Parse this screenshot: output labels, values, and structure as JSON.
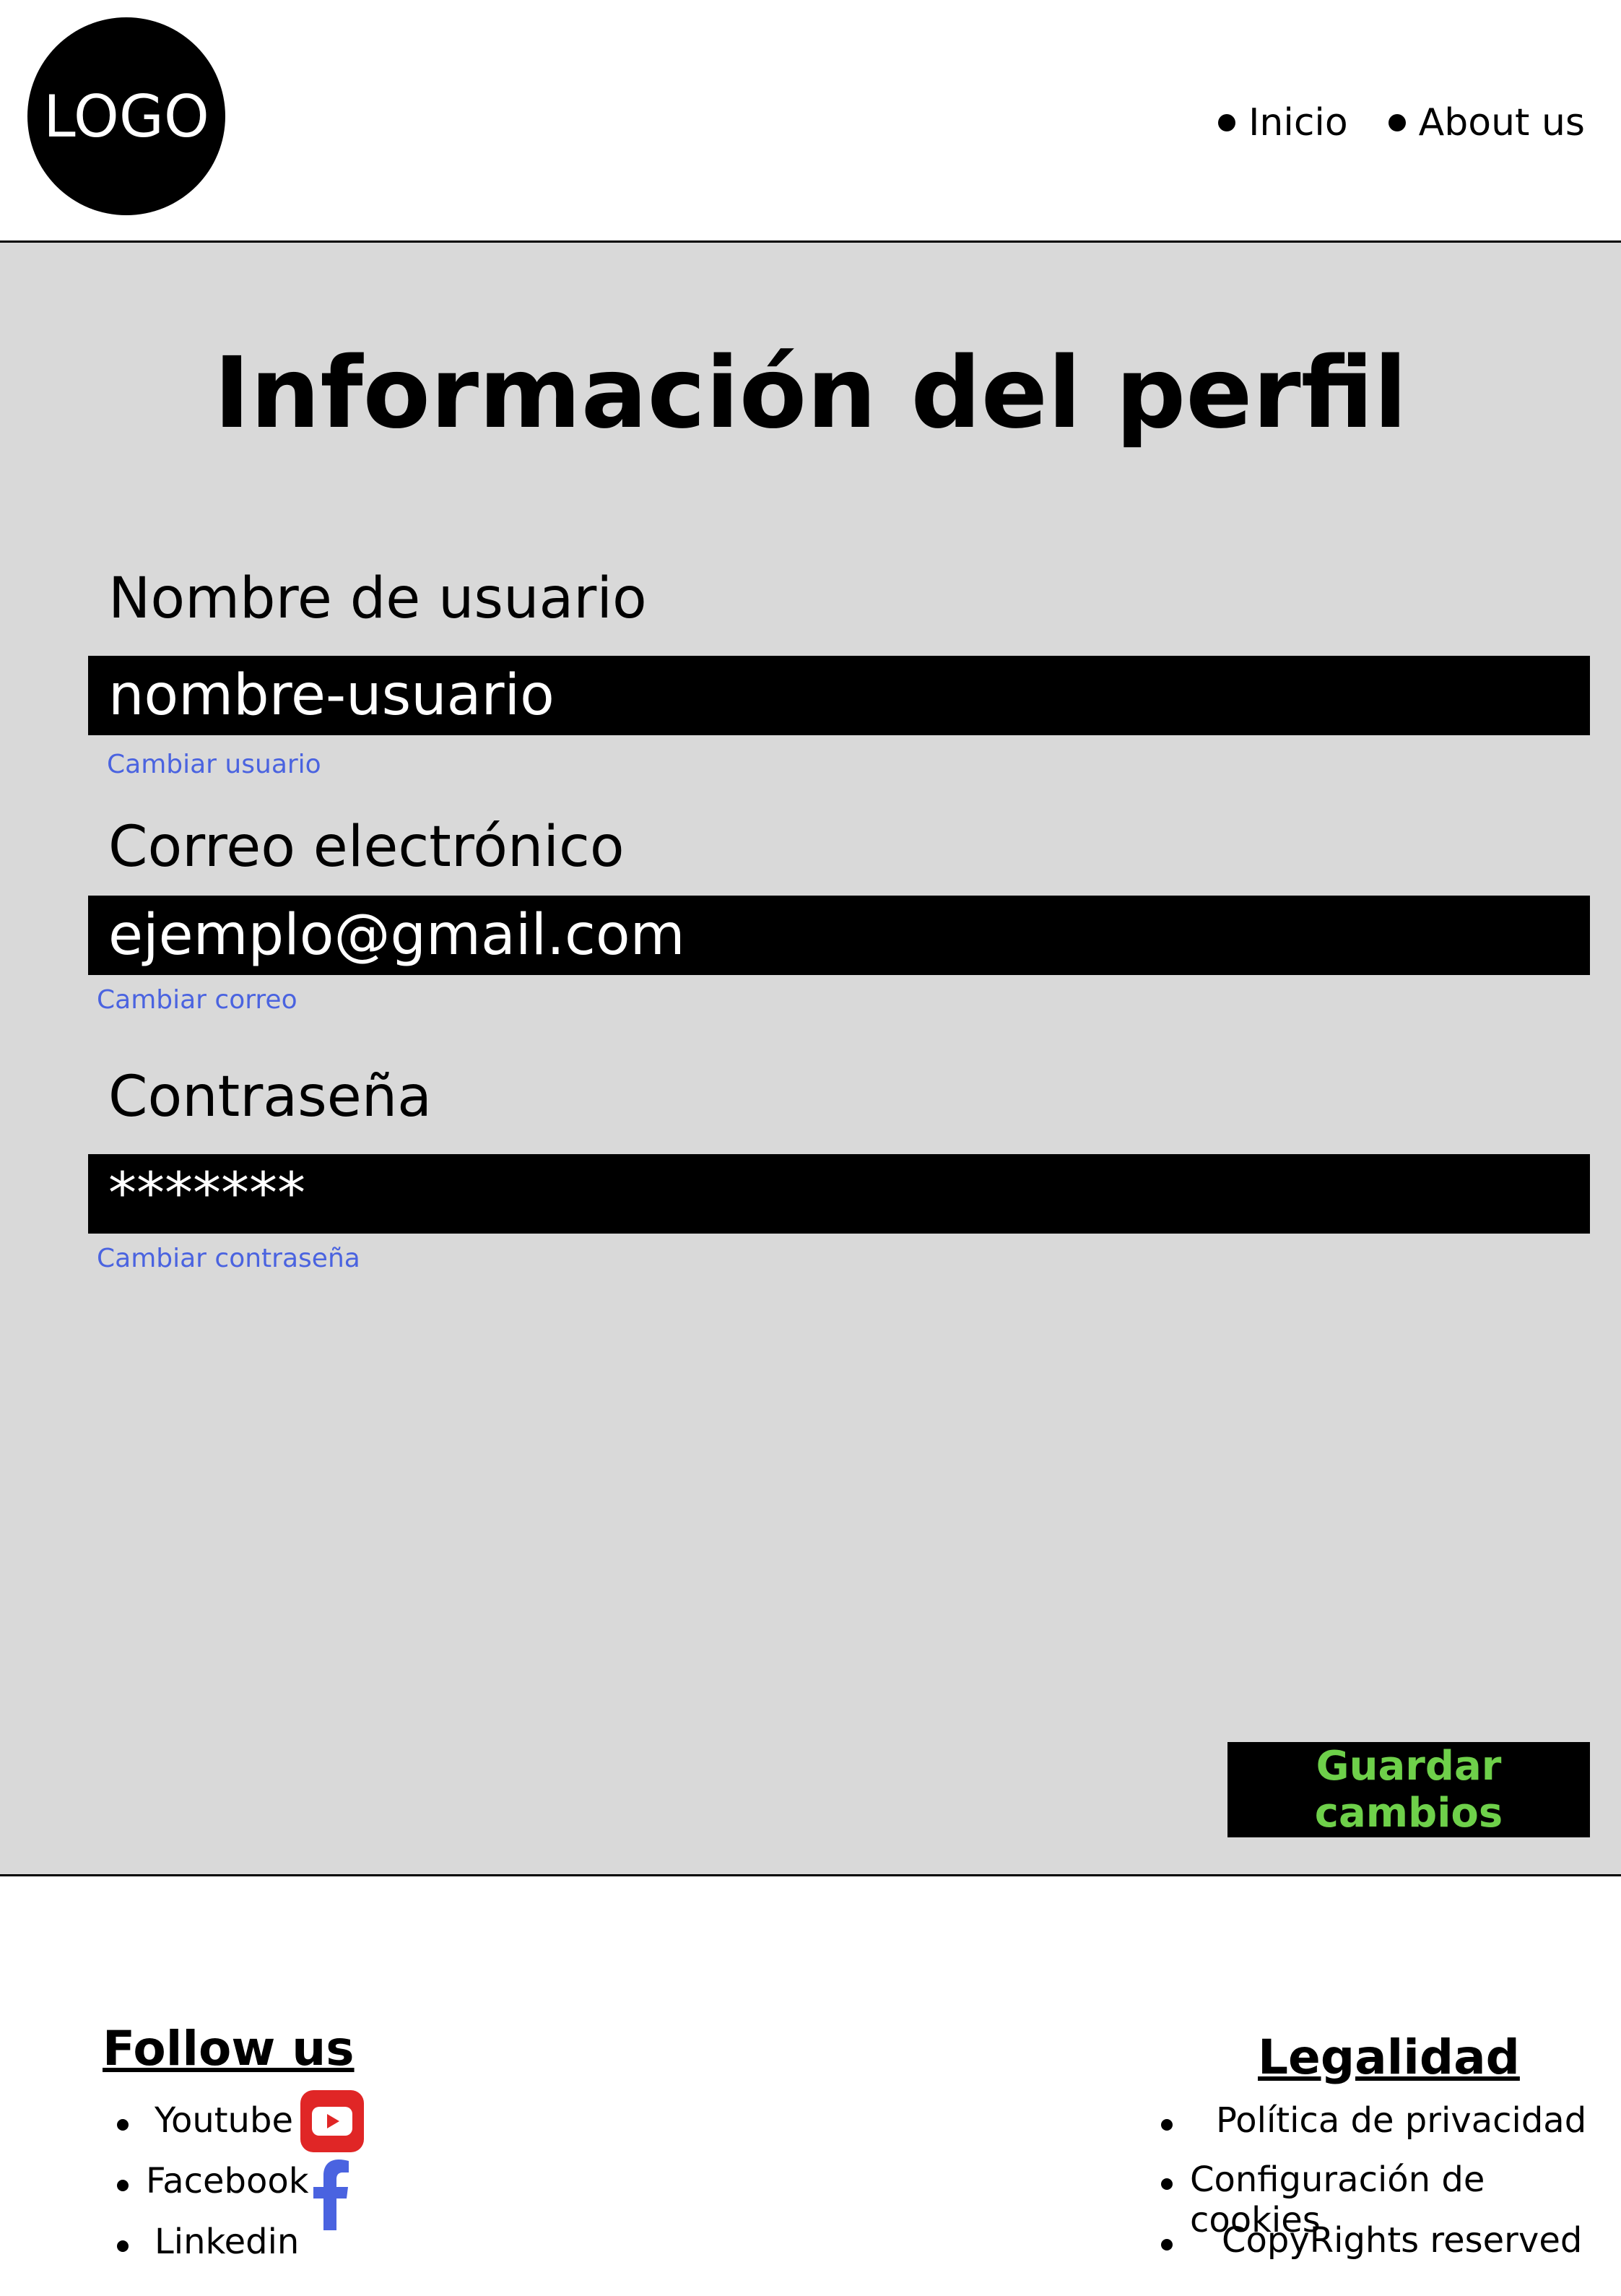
{
  "header": {
    "logo_text": "LOGO",
    "nav": [
      {
        "label": "Inicio"
      },
      {
        "label": "About us"
      }
    ]
  },
  "main": {
    "title": "Información del perfil",
    "username": {
      "label": "Nombre de usuario",
      "value": "nombre-usuario",
      "change_link": "Cambiar usuario"
    },
    "email": {
      "label": "Correo electrónico",
      "value": "ejemplo@gmail.com",
      "change_link": "Cambiar correo"
    },
    "password": {
      "label": "Contraseña",
      "value": "*******",
      "change_link": "Cambiar contraseña"
    },
    "save_label": "Guardar cambios"
  },
  "footer": {
    "follow": {
      "title": "Follow us",
      "items": [
        {
          "label": "Youtube",
          "icon": "youtube-icon"
        },
        {
          "label": "Facebook",
          "icon": "facebook-icon"
        },
        {
          "label": "Linkedin"
        }
      ]
    },
    "legal": {
      "title": "Legalidad",
      "items": [
        {
          "label": "Política de privacidad"
        },
        {
          "label": "Configuración de cookies"
        },
        {
          "label": "CopyRights reserved"
        }
      ]
    }
  },
  "colors": {
    "link": "#4a63e0",
    "save_text": "#6ed04a",
    "main_bg": "#d9d9d9",
    "youtube": "#e02626",
    "facebook": "#4a63e0"
  }
}
